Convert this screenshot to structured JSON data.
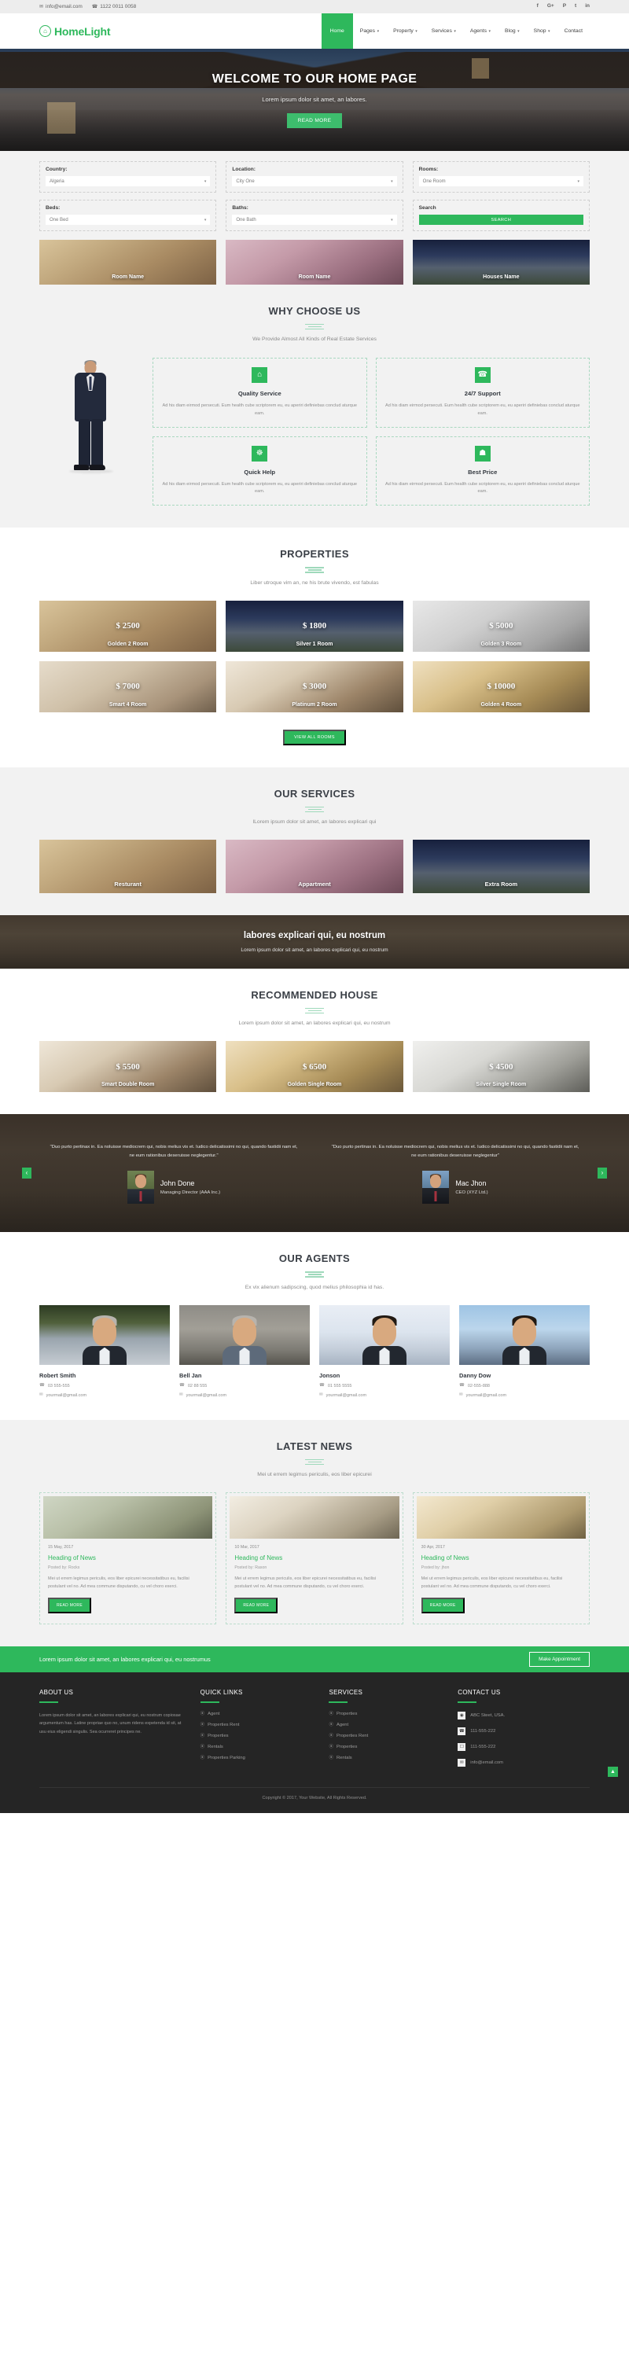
{
  "topbar": {
    "email": "info@email.com",
    "email_icon": "envelope-icon",
    "phone": "1122 0011 0058",
    "phone_icon": "phone-icon",
    "socials": [
      {
        "name": "facebook-icon",
        "glyph": "f"
      },
      {
        "name": "google-plus-icon",
        "glyph": "G+"
      },
      {
        "name": "pinterest-icon",
        "glyph": "P"
      },
      {
        "name": "twitter-icon",
        "glyph": "t"
      },
      {
        "name": "linkedin-icon",
        "glyph": "in"
      }
    ]
  },
  "brand": {
    "name": "HomeLight",
    "icon": "home-in-circle-icon",
    "glyph": "⌂"
  },
  "nav": [
    {
      "label": "Home",
      "active": true,
      "dropdown": false
    },
    {
      "label": "Pages",
      "active": false,
      "dropdown": true
    },
    {
      "label": "Property",
      "active": false,
      "dropdown": true
    },
    {
      "label": "Services",
      "active": false,
      "dropdown": true
    },
    {
      "label": "Agents",
      "active": false,
      "dropdown": true
    },
    {
      "label": "Blog",
      "active": false,
      "dropdown": true
    },
    {
      "label": "Shop",
      "active": false,
      "dropdown": true
    },
    {
      "label": "Contact",
      "active": false,
      "dropdown": false
    }
  ],
  "hero": {
    "title": "WELCOME TO OUR HOME PAGE",
    "subtitle": "Lorem ipsum dolor sit amet, an labores.",
    "button": "READ MORE"
  },
  "search": {
    "fields": [
      {
        "label": "Country:",
        "value": "Algeria"
      },
      {
        "label": "Location:",
        "value": "City One"
      },
      {
        "label": "Rooms:",
        "value": "One Room"
      },
      {
        "label": "Beds:",
        "value": "One Bed"
      },
      {
        "label": "Baths:",
        "value": "One Bath"
      }
    ],
    "search_label": "Search",
    "search_button": "SEARCH"
  },
  "teasers": [
    {
      "caption": "Room Name",
      "img": "img-livingroom"
    },
    {
      "caption": "Room Name",
      "img": "img-nursery"
    },
    {
      "caption": "Houses Name",
      "img": "img-house"
    }
  ],
  "why": {
    "title": "WHY CHOOSE US",
    "subtitle": "We Provide Almost All Kinds of Real Estate Services",
    "cards": [
      {
        "icon": "home-icon",
        "glyph": "⌂",
        "title": "Quality Service",
        "text": "Ad his diam eirmod persecuti. Eum health cube scriptorem eu, eu aperiri definiebas conclud aturque eam."
      },
      {
        "icon": "headset-icon",
        "glyph": "☎",
        "title": "24/7 Support",
        "text": "Ad his diam eirmod persecuti. Eum health cube scriptorem eu, eu aperiri definiebas conclud aturque eam."
      },
      {
        "icon": "lifebuoy-icon",
        "glyph": "☸",
        "title": "Quick Help",
        "text": "Ad his diam eirmod persecuti. Eum health cube scriptorem eu, eu aperiri definiebas conclud aturque eam."
      },
      {
        "icon": "gift-icon",
        "glyph": "☗",
        "title": "Best Price",
        "text": "Ad his diam eirmod persecuti. Eum health cube scriptorem eu, eu aperiri definiebas conclud aturque eam."
      }
    ]
  },
  "properties": {
    "title": "PROPERTIES",
    "subtitle": "Liber utroque vim an, ne his brute vivendo, est fabulas",
    "items": [
      {
        "price": "$ 2500",
        "name": "Golden 2 Room",
        "img": "img-livingroom"
      },
      {
        "price": "$ 1800",
        "name": "Silver 1 Room",
        "img": "img-house"
      },
      {
        "price": "$ 5000",
        "name": "Golden 3 Room",
        "img": "img-greyroom"
      },
      {
        "price": "$ 7000",
        "name": "Smart 4 Room",
        "img": "img-bedroom-a"
      },
      {
        "price": "$ 3000",
        "name": "Platinum 2 Room",
        "img": "img-bedroom-b"
      },
      {
        "price": "$ 10000",
        "name": "Golden 4 Room",
        "img": "img-bedroom-c"
      }
    ],
    "view_all": "VIEW ALL ROOMS"
  },
  "services": {
    "title": "OUR SERVICES",
    "subtitle": "lLorem ipsum dolor sit amet, an labores explicari qui",
    "items": [
      {
        "name": "Resturant",
        "img": "img-livingroom"
      },
      {
        "name": "Appartment",
        "img": "img-nursery"
      },
      {
        "name": "Extra Room",
        "img": "img-house"
      }
    ]
  },
  "parallax": {
    "title": "labores explicari qui, eu nostrum",
    "subtitle": "Lorem ipsum dolor sit amet, an labores explicari qui, eu nostrum"
  },
  "recommended": {
    "title": "RECOMMENDED HOUSE",
    "subtitle": "Lorem ipsum dolor sit amet, an labores explicari qui, eu nostrum",
    "items": [
      {
        "price": "$ 5500",
        "name": "Smart Double Room",
        "img": "img-bedroom-b"
      },
      {
        "price": "$ 6500",
        "name": "Golden Single Room",
        "img": "img-bedroom-c"
      },
      {
        "price": "$ 4500",
        "name": "Silver Single Room",
        "img": "img-kitchen"
      }
    ]
  },
  "testimonials": {
    "prev_icon": "chevron-left-icon",
    "next_icon": "chevron-right-icon",
    "prev_glyph": "‹",
    "next_glyph": "›",
    "items": [
      {
        "quote": "\"Duo purto pertinax in. Ea noluisse mediocrem qui, nobis melius vis et. Iudico delicatissimi no qui, quando fastidii nam et, ne eum rationibus deseruisse neglegentur.\"",
        "name": "John Done",
        "role": "Managing Director (AAA Inc.)"
      },
      {
        "quote": "\"Duo purto pertinax in. Ea noluisse mediocrem qui, nobis melius vis et. Iudico delicatissimi no qui, quando fastidii nam et, ne eum rationibus deseruisse neglegentur\"",
        "name": "Mac Jhon",
        "role": "CEO (XYZ Ltd.)"
      }
    ]
  },
  "agents": {
    "title": "OUR AGENTS",
    "subtitle": "Ex vix alienum sadipscing, quod melius philosophia id has.",
    "phone_icon": "phone-icon",
    "email_icon": "envelope-icon",
    "items": [
      {
        "name": "Robert Smith",
        "phone": "03 555-555",
        "email": "yourmail@gmail.com"
      },
      {
        "name": "Bell Jan",
        "phone": "02 88 555",
        "email": "yourmail@gmail.com"
      },
      {
        "name": "Jonson",
        "phone": "01 555 5555",
        "email": "yourmail@gmail.com"
      },
      {
        "name": "Danny Dow",
        "phone": "02-555-888",
        "email": "yourmail@gmail.com"
      }
    ]
  },
  "news": {
    "title": "LATEST NEWS",
    "subtitle": "Mei ut errem legimus periculis, eos liber epicurei",
    "read_more": "READ MORE",
    "items": [
      {
        "date": "15 May, 2017",
        "heading": "Heading of News",
        "posted": "Posted by: Rocks",
        "text": "Mei ut errem legimus periculis, eos liber epicurei necessitatibus eu, facilisi postulant vel no. Ad mea commune disputando, cu vel choro exerci.",
        "img": "img-newsroom-a"
      },
      {
        "date": "10 Mar, 2017",
        "heading": "Heading of News",
        "posted": "Posted by: Rason",
        "text": "Mei ut errem legimus periculis, eos liber epicurei necessitatibus eu, facilisi postulant vel no. Ad mea commune disputando, cu vel choro exerci.",
        "img": "img-newsroom-b"
      },
      {
        "date": "30 Apr, 2017",
        "heading": "Heading of News",
        "posted": "Posted by: jhon",
        "text": "Mei ut errem legimus periculis, eos liber epicurei necessitatibus eu, facilisi postulant vel no. Ad mea commune disputando, cu vel choro exerci.",
        "img": "img-newsroom-c"
      }
    ]
  },
  "cta": {
    "text": "Lorem ipsum dolor sit amet, an labores explicari qui, eu nostrumus",
    "button": "Make Appointment"
  },
  "footer": {
    "about": {
      "title": "ABOUT US",
      "text": "Lorem ipsum dolor sit amet, an labores explicari qui, eu nostrum copiosae argumentum has. Latine propriae quo no, unum ridens expetenda id sit, at usu eius eligendi singulis. Sea ocurreret principes ne."
    },
    "quick_links": {
      "title": "QUICK LINKS",
      "items": [
        "Agent",
        "Properties Rent",
        "Properties",
        "Rentals",
        "Properties Parking"
      ]
    },
    "services": {
      "title": "SERVICES",
      "items": [
        "Properties",
        "Agent",
        "Properties Rent",
        "Properties",
        "Rentals"
      ]
    },
    "contact": {
      "title": "CONTACT US",
      "items": [
        {
          "icon": "map-marker-icon",
          "glyph": "◉",
          "text": "ABC Steet, USA."
        },
        {
          "icon": "phone-icon",
          "glyph": "☎",
          "text": "111-555-222"
        },
        {
          "icon": "mobile-icon",
          "glyph": "☐",
          "text": "111-555-222"
        },
        {
          "icon": "envelope-icon",
          "glyph": "✉",
          "text": "info@email.com"
        }
      ]
    },
    "copyright": "Copyright © 2017, Your Website, All Rights Reserved.",
    "to_top_icon": "chevron-up-icon",
    "to_top_glyph": "▲"
  },
  "colors": {
    "accent": "#2eb85c",
    "dark": "#252525",
    "grey_bg": "#f2f2f2"
  }
}
